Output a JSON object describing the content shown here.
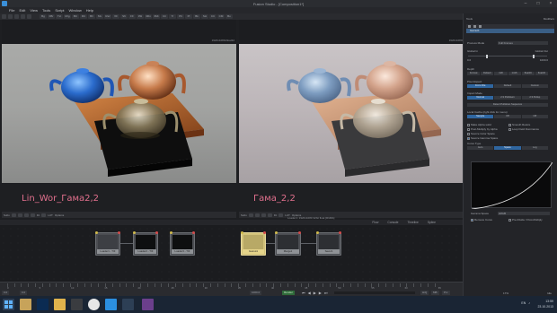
{
  "app": {
    "title": "Fusion Studio - [Composition1*]",
    "menu": [
      "File",
      "Edit",
      "View",
      "Tools",
      "Script",
      "Window",
      "Help"
    ]
  },
  "toolbar": {
    "tools": [
      "Bg",
      "FBr",
      "Txt",
      "Mrg",
      "BC",
      "RC",
      "Blr",
      "Mx",
      "Rsz",
      "XF",
      "Sft",
      "FF",
      "3SI",
      "3Rn",
      "3Mt",
      "Ctr",
      "Tr",
      "Plt",
      "Pl",
      "Bk",
      "SH",
      "CC",
      "CM",
      "Bo"
    ]
  },
  "viewers": {
    "left": {
      "caption": "Lin_Wor_Гама2,2",
      "header": "1920x1080xfloat32"
    },
    "right": {
      "caption": "Гама_2,2",
      "header": "1920x1080xfloat32"
    },
    "zoom_label": "Subv",
    "fit_label": "Fit",
    "lut_label": "LUT",
    "options_label": "Options",
    "status": "Loader1: 1920x1080 32bit float [RGBA]"
  },
  "flow": {
    "tabs": [
      "Flow",
      "Console",
      "Timeline",
      "Spline"
    ],
    "nodes": [
      {
        "label": "Loader1 - TIF",
        "style": "grey"
      },
      {
        "label": "Loader2 - TIF",
        "style": "grey"
      },
      {
        "label": "Loader3 - TIF",
        "style": "grey"
      },
      {
        "label": "Gamut1",
        "style": "yellow"
      },
      {
        "label": "Merge1",
        "style": "grey"
      },
      {
        "label": "Saver1",
        "style": "grey"
      }
    ]
  },
  "timeline": {
    "ticks": [
      "0",
      "5",
      "10",
      "15",
      "20",
      "25",
      "30",
      "35",
      "40",
      "45",
      "50",
      "55",
      "60",
      "65"
    ],
    "start": "0.0",
    "end": "1000.0",
    "current": "0.0",
    "render_label": "Render",
    "hiq_label": "HiQ",
    "mb_label": "MB",
    "prx_label": "Prx"
  },
  "inspector": {
    "tabs": [
      "Tools",
      "Modifiers"
    ],
    "tool_name": "Gamut1",
    "process_mode_label": "Process Mode",
    "process_mode_value": "Full Frames",
    "global_in_label": "Global In",
    "global_out_label": "Global Out",
    "global_in_value": "0.0",
    "global_out_value": "1000.0",
    "depth_label": "Depth",
    "depth_options": [
      "Format",
      "Default",
      "int8",
      "int16",
      "float16",
      "float32"
    ],
    "pixel_aspect_label": "Pixel Aspect",
    "pixel_aspect_options": [
      "From File",
      "Default",
      "Custom"
    ],
    "import_mode_label": "Import Mode",
    "import_options": [
      "Normal",
      "2:3 Pulldown",
      "2:3 Pullup"
    ],
    "detect_label": "Detect Pulldown Sequence",
    "source_label": "Local Cache (right click for menu)",
    "space_options": [
      "Sample",
      "Off",
      "Off"
    ],
    "checks": [
      {
        "label": "Make Alpha solid",
        "on": false
      },
      {
        "label": "Smooth Resize",
        "on": false
      },
      {
        "label": "Post-Multiply by Alpha",
        "on": false
      },
      {
        "label": "Loop Field Dominance",
        "on": false
      },
      {
        "label": "Source Color Space",
        "on": false
      },
      {
        "label": "Source Gamma Space",
        "on": true
      }
    ],
    "curve_type_label": "Curve Type",
    "curve_options": [
      "Auto",
      "Space",
      "Log"
    ],
    "gamma_space_label": "Gamma Space",
    "gamma_space_value": "sRGB",
    "remove_curve_label": "Remove Curve",
    "pre_divide_label": "Pre-Divide / Post-Multiply"
  },
  "statusbar": {
    "left": "17%",
    "mem": "Playback: 0 frames/sec",
    "right": "Idle"
  },
  "taskbar": {
    "lang": "EN",
    "time": "13:59",
    "date": "23.10.2013"
  },
  "colors": {
    "caption": "#e1708d",
    "accent": "#2f66a0",
    "node_yellow": "#d2c27a",
    "render_green": "#2f6a3a"
  }
}
